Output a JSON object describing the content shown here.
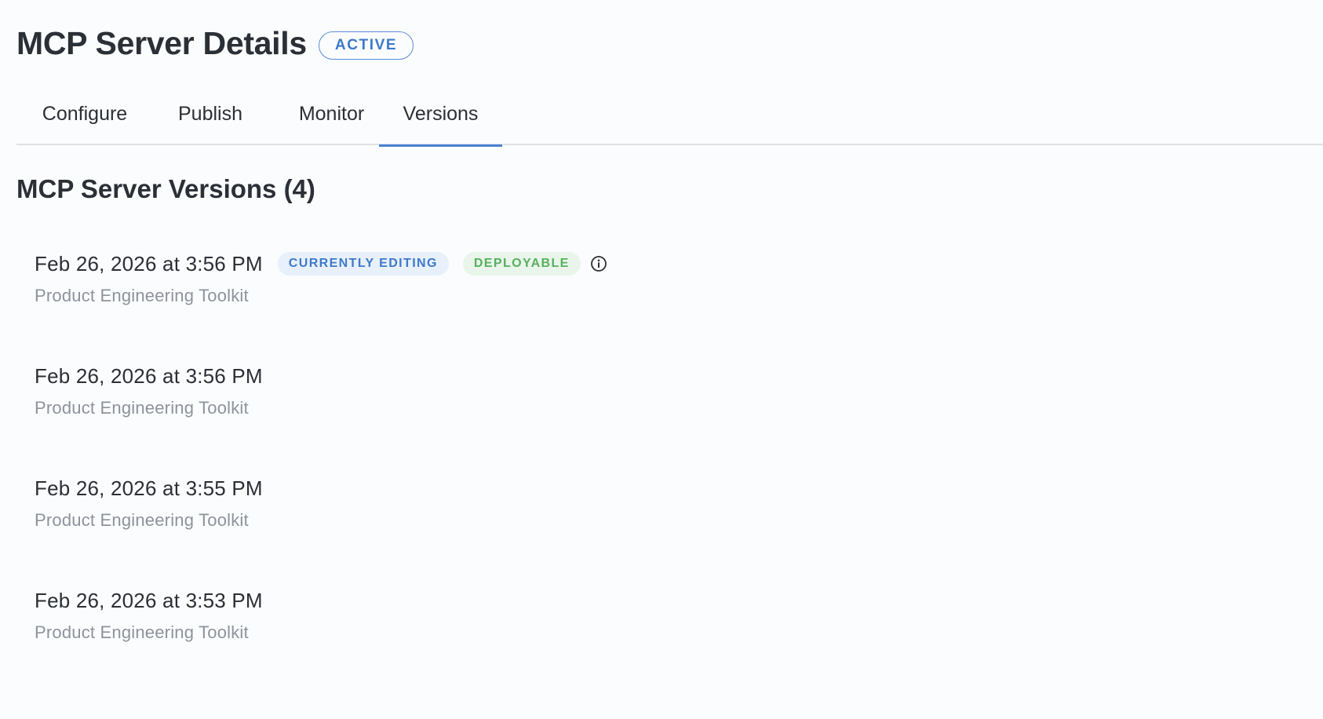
{
  "header": {
    "title": "MCP Server Details",
    "status": "ACTIVE"
  },
  "tabs": [
    {
      "label": "Configure",
      "active": false
    },
    {
      "label": "Publish",
      "active": false
    },
    {
      "label": "Monitor",
      "active": false
    },
    {
      "label": "Versions",
      "active": true
    }
  ],
  "section": {
    "title": "MCP Server Versions (4)"
  },
  "versions": [
    {
      "date": "Feb 26, 2026 at 3:56 PM",
      "name": "Product Engineering Toolkit",
      "badges": [
        "CURRENTLY EDITING",
        "DEPLOYABLE"
      ],
      "info_icon": "info-icon"
    },
    {
      "date": "Feb 26, 2026 at 3:56 PM",
      "name": "Product Engineering Toolkit"
    },
    {
      "date": "Feb 26, 2026 at 3:55 PM",
      "name": "Product Engineering Toolkit"
    },
    {
      "date": "Feb 26, 2026 at 3:53 PM",
      "name": "Product Engineering Toolkit"
    }
  ],
  "colors": {
    "accent": "#4a80d2",
    "deployable": "#56b05e",
    "muted_text": "#8d939c",
    "background": "#fbfcfd"
  }
}
